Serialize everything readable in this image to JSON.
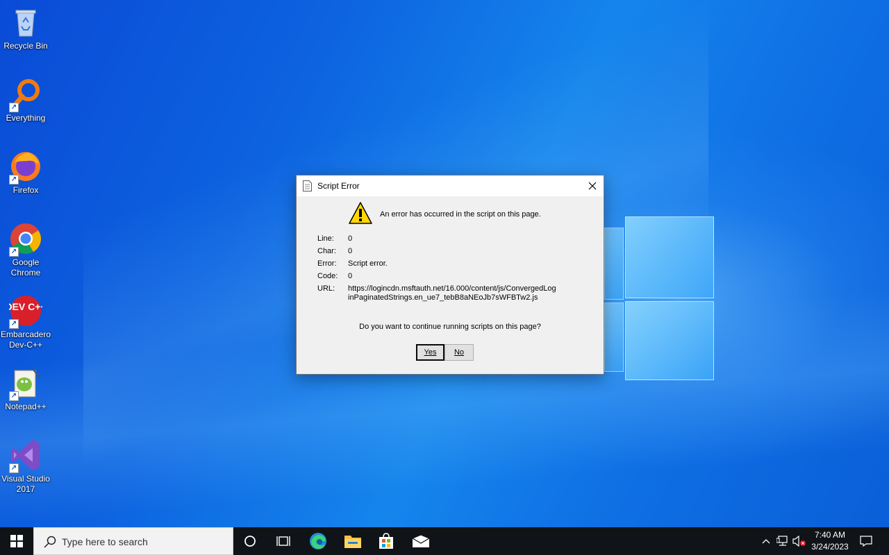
{
  "desktop": {
    "icons": [
      {
        "label": "Recycle Bin",
        "icon": "recycle-bin-icon"
      },
      {
        "label": "Everything",
        "icon": "everything-search-icon"
      },
      {
        "label": "Firefox",
        "icon": "firefox-icon"
      },
      {
        "label": "Google Chrome",
        "icon": "chrome-icon"
      },
      {
        "label": "Embarcadero Dev-C++",
        "icon": "devcpp-icon",
        "icon_text": "DEV C++"
      },
      {
        "label": "Notepad++",
        "icon": "notepadpp-icon"
      },
      {
        "label": "Visual Studio 2017",
        "icon": "visual-studio-icon"
      }
    ]
  },
  "dialog": {
    "title": "Script Error",
    "message": "An error has occurred in the script on this page.",
    "fields": [
      {
        "label": "Line:",
        "value": "0"
      },
      {
        "label": "Char:",
        "value": "0"
      },
      {
        "label": "Error:",
        "value": "Script error."
      },
      {
        "label": "Code:",
        "value": "0"
      },
      {
        "label": "URL:",
        "value": "https://logincdn.msftauth.net/16.000/content/js/ConvergedLoginPaginatedStrings.en_ue7_tebB8aNEoJb7sWFBTw2.js"
      }
    ],
    "question": "Do you want to continue running scripts on this page?",
    "yes_label": "Yes",
    "no_label": "No"
  },
  "taskbar": {
    "search_placeholder": "Type here to search",
    "apps": [
      "cortana-icon",
      "task-view-icon",
      "edge-icon",
      "file-explorer-icon",
      "store-icon",
      "mail-icon"
    ],
    "clock_time": "7:40 AM",
    "clock_date": "3/24/2023"
  },
  "colors": {
    "taskbar_bg": "#101418",
    "desktop_blue": "#0d63e0",
    "dialog_bg": "#f0f0f0"
  }
}
